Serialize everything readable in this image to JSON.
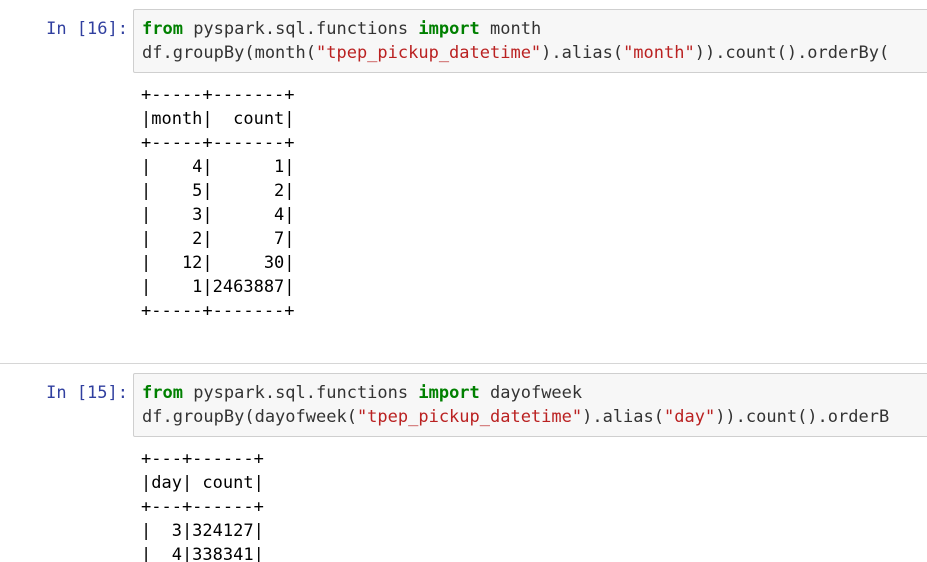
{
  "cells": [
    {
      "prompt": "In [16]:",
      "code": {
        "line1": {
          "kw1": "from",
          "module": " pyspark.sql.functions ",
          "kw2": "import",
          "name": " month"
        },
        "line2": {
          "p1": "df.groupBy(month(",
          "s1": "\"tpep_pickup_datetime\"",
          "p2": ").alias(",
          "s2": "\"month\"",
          "p3": ")).count().orderBy("
        }
      },
      "output": [
        "+-----+-------+",
        "|month|  count|",
        "+-----+-------+",
        "|    4|      1|",
        "|    5|      2|",
        "|    3|      4|",
        "|    2|      7|",
        "|   12|     30|",
        "|    1|2463887|",
        "+-----+-------+"
      ]
    },
    {
      "prompt": "In [15]:",
      "code": {
        "line1": {
          "kw1": "from",
          "module": " pyspark.sql.functions ",
          "kw2": "import",
          "name": " dayofweek"
        },
        "line2": {
          "p1": "df.groupBy(dayofweek(",
          "s1": "\"tpep_pickup_datetime\"",
          "p2": ").alias(",
          "s2": "\"day\"",
          "p3": ")).count().orderB"
        }
      },
      "output": [
        "+---+------+",
        "|day| count|",
        "+---+------+",
        "|  3|324127|",
        "|  4|338341|"
      ]
    }
  ],
  "colors": {
    "prompt": "#303f9f",
    "keyword": "#008000",
    "string": "#ba2121",
    "input_bg": "#f7f7f7",
    "input_border": "#cfcfcf"
  }
}
